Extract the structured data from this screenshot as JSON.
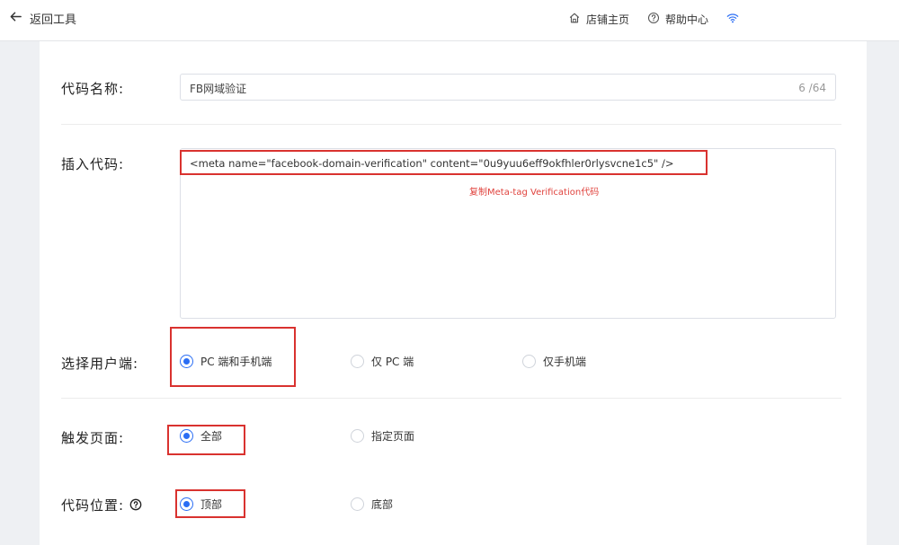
{
  "header": {
    "back_label": "返回工具",
    "links": [
      {
        "label": "店铺主页",
        "icon": "home-icon"
      },
      {
        "label": "帮助中心",
        "icon": "help-circle-icon"
      }
    ],
    "status_icon": "wifi-icon"
  },
  "form": {
    "code_name": {
      "label": "代码名称:",
      "value": "FB网域验证",
      "count": "6 /64"
    },
    "insert_code": {
      "label": "插入代码:",
      "value": "<meta name=\"facebook-domain-verification\" content=\"0u9yuu6eff9okfhler0rlysvcne1c5\" />",
      "annotation": "复制Meta-tag Verification代码"
    },
    "client": {
      "label": "选择用户端:",
      "options": [
        "PC 端和手机端",
        "仅 PC 端",
        "仅手机端"
      ],
      "selected": "PC 端和手机端"
    },
    "trigger_page": {
      "label": "触发页面:",
      "options": [
        "全部",
        "指定页面"
      ],
      "selected": "全部"
    },
    "code_position": {
      "label": "代码位置:",
      "options": [
        "顶部",
        "底部"
      ],
      "selected": "顶部"
    }
  },
  "colors": {
    "accent": "#2a6df4",
    "highlight": "#d9322f",
    "annotation": "#e0433e"
  }
}
